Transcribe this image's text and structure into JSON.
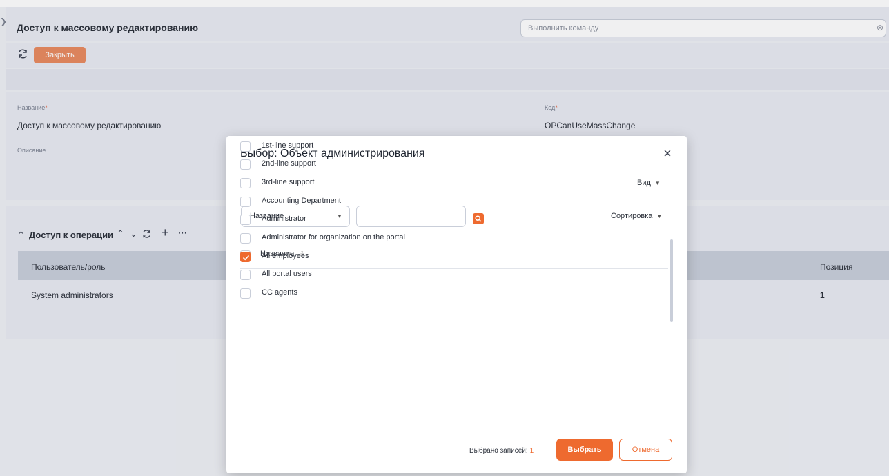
{
  "header": {
    "title": "Доступ к массовому редактированию",
    "command_placeholder": "Выполнить команду"
  },
  "toolbar": {
    "close_label": "Закрыть"
  },
  "form": {
    "name_label": "Название",
    "name_value": "Доступ к массовому редактированию",
    "code_label": "Код",
    "code_value": "OPCanUseMassChange",
    "description_label": "Описание",
    "required_mark": "*"
  },
  "operations": {
    "title": "Доступ к операции",
    "columns": [
      "Пользователь/роль",
      "Позиция"
    ],
    "rows": [
      {
        "user_role": "System administrators",
        "position": "1"
      }
    ]
  },
  "modal": {
    "title": "Выбор: Объект администрирования",
    "view_label": "Вид",
    "field_select": "Название",
    "search_value": "",
    "sort_label": "Сортировка",
    "list_header": "Название",
    "items": [
      {
        "label": "1st-line support",
        "checked": false
      },
      {
        "label": "2nd-line support",
        "checked": false
      },
      {
        "label": "3rd-line support",
        "checked": false
      },
      {
        "label": "Accounting Department",
        "checked": false
      },
      {
        "label": "Administrator",
        "checked": false
      },
      {
        "label": "Administrator for organization on the portal",
        "checked": false
      },
      {
        "label": "All employees",
        "checked": true
      },
      {
        "label": "All portal users",
        "checked": false
      },
      {
        "label": "CC agents",
        "checked": false
      }
    ],
    "selected_label": "Выбрано записей:",
    "selected_count": "1",
    "select_button": "Выбрать",
    "cancel_button": "Отмена"
  },
  "colors": {
    "accent": "#ee6a2f",
    "close_button": "#e98a5f",
    "background": "#eef0f5"
  }
}
